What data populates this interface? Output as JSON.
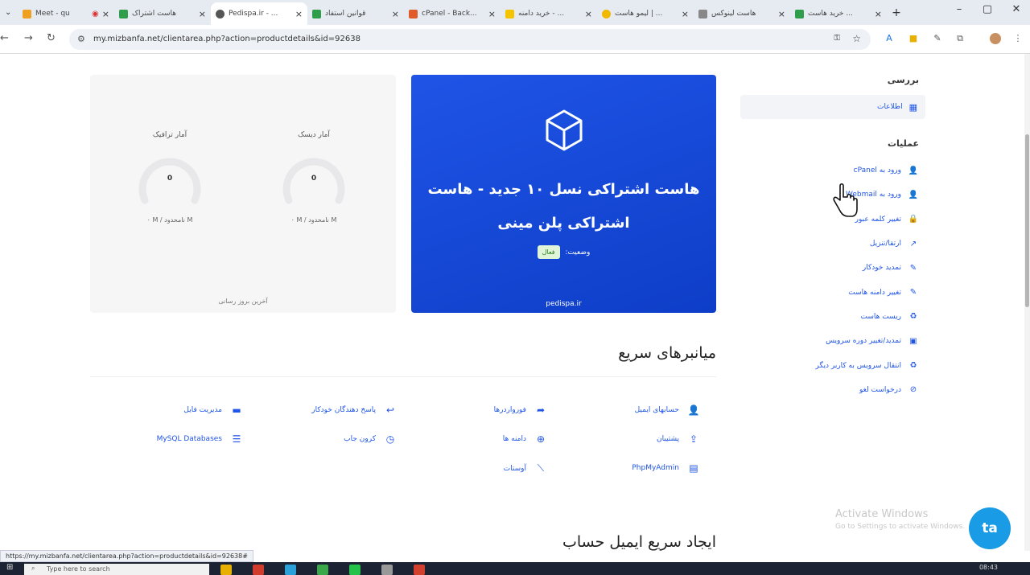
{
  "browser": {
    "tabs": [
      {
        "title": "Meet - qu",
        "color": "#f0a020"
      },
      {
        "title": "هاست اشتراک",
        "color": "#2e9e4a"
      },
      {
        "title": "Pedispa.ir - ...",
        "color": "#555555",
        "active": true
      },
      {
        "title": "قوانین استفاد",
        "color": "#2e9e4a"
      },
      {
        "title": "cPanel - Back...",
        "color": "#e05a2a"
      },
      {
        "title": "خرید دامنه - ...",
        "color": "#f5c400"
      },
      {
        "title": "لیمو هاست | ...",
        "color": "#f0b800"
      },
      {
        "title": "هاست لینوکس",
        "color": "#888888"
      },
      {
        "title": "خرید هاست ...",
        "color": "#2e9e4a"
      }
    ],
    "new_tab": "+",
    "url": "my.mizbanfa.net/clientarea.php?action=productdetails&id=92638"
  },
  "stats": {
    "disk_label": "آمار دیسک",
    "disk_value": "0",
    "disk_usage": "۰ M / نامحدود M",
    "traffic_label": "آمار ترافیک",
    "traffic_value": "0",
    "traffic_usage": "۰ M / نامحدود M",
    "last_update": "آخرین بروز رسانی"
  },
  "hero": {
    "product_name": "هاست اشتراکی نسل ۱۰ جدید - هاست اشتراکی پلن مینی",
    "status_label": "وضعیت:",
    "status_value": "فعال",
    "domain": "pedispa.ir"
  },
  "sidebar": {
    "overview_title": "بررسی",
    "info_label": "اطلاعات",
    "actions_title": "عملیات",
    "items": [
      {
        "label": "ورود به cPanel",
        "icon": "user-icon",
        "glyph": "👤"
      },
      {
        "label": "ورود به Webmail",
        "icon": "user-icon",
        "glyph": "👤"
      },
      {
        "label": "تغییر کلمه عبور",
        "icon": "lock-icon",
        "glyph": "🔒"
      },
      {
        "label": "ارتقا/تنزیل",
        "icon": "external-icon",
        "glyph": "↗"
      },
      {
        "label": "تمدید خودکار",
        "icon": "edit-icon",
        "glyph": "✎"
      },
      {
        "label": "تغییر دامنه هاست",
        "icon": "edit-icon",
        "glyph": "✎"
      },
      {
        "label": "ریست هاست",
        "icon": "recycle-icon",
        "glyph": "♻"
      },
      {
        "label": "تمدید/تغییر دوره سرویس",
        "icon": "calendar-icon",
        "glyph": "▣"
      },
      {
        "label": "انتقال سرویس به کاربر دیگر",
        "icon": "recycle-icon",
        "glyph": "♻"
      },
      {
        "label": "درخواست لغو",
        "icon": "ban-icon",
        "glyph": "⊘"
      }
    ]
  },
  "shortcuts": {
    "title": "میانبرهای سریع",
    "items": [
      {
        "label": "حسابهای ایمیل",
        "icon": "user-icon",
        "glyph": "👤"
      },
      {
        "label": "فورواردرها",
        "icon": "share-icon",
        "glyph": "➦"
      },
      {
        "label": "پاسخ دهندگان خودکار",
        "icon": "reply-icon",
        "glyph": "↩"
      },
      {
        "label": "مدیریت فایل",
        "icon": "folder-icon",
        "glyph": "▬"
      },
      {
        "label": "پشتیبان",
        "icon": "user-upload-icon",
        "glyph": "⇪"
      },
      {
        "label": "دامنه ها",
        "icon": "globe-icon",
        "glyph": "⊕"
      },
      {
        "label": "کرون جاب",
        "icon": "clock-icon",
        "glyph": "◷"
      },
      {
        "label": "MySQL Databases",
        "icon": "database-icon",
        "glyph": "☰"
      },
      {
        "label": "PhpMyAdmin",
        "icon": "window-icon",
        "glyph": "▤"
      },
      {
        "label": "آوستات",
        "icon": "chart-icon",
        "glyph": "⟋"
      }
    ]
  },
  "email_section_title": "ایجاد سریع ایمیل حساب",
  "watermark": {
    "line1": "Activate Windows",
    "line2": "Go to Settings to activate Windows."
  },
  "chat_label": "ta",
  "status_link": "https://my.mizbanfa.net/clientarea.php?action=productdetails&id=92638#",
  "taskbar": {
    "search_placeholder": "Type here to search",
    "time": "08:43"
  },
  "colors": {
    "accent": "#1f54e6",
    "hero_bg": "#1547d8",
    "chat_bg": "#1a9be6"
  }
}
